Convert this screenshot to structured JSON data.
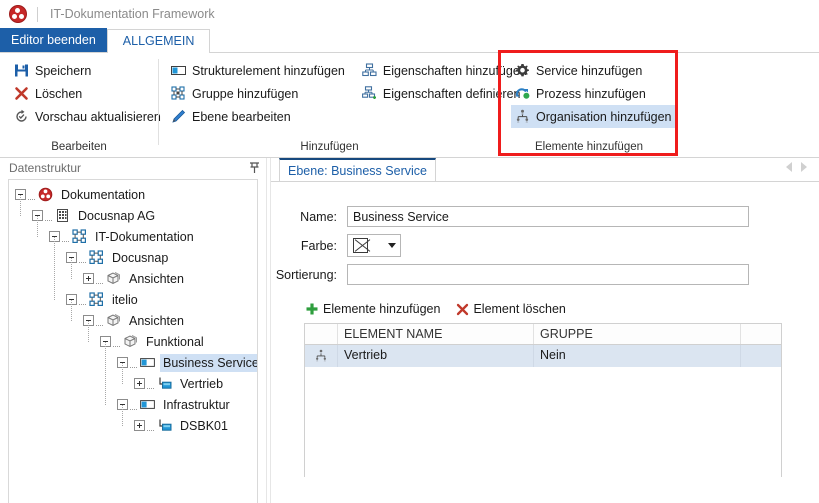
{
  "window": {
    "app_logo": "docusnap-logo-icon",
    "title": "IT-Dokumentation Framework"
  },
  "tabs": {
    "file_tab": "Editor beenden",
    "general_tab": "ALLGEMEIN"
  },
  "ribbon": {
    "groups": [
      {
        "name": "bearbeiten",
        "label": "Bearbeiten",
        "items": [
          {
            "label": "Speichern",
            "icon": "save-icon"
          },
          {
            "label": "Löschen",
            "icon": "delete-x-icon"
          },
          {
            "label": "Vorschau aktualisieren",
            "icon": "refresh-preview-icon"
          }
        ]
      },
      {
        "name": "hinzufuegen",
        "label": "Hinzufügen",
        "items_col1": [
          {
            "label": "Strukturelement hinzufügen",
            "icon": "structure-element-icon"
          },
          {
            "label": "Gruppe hinzufügen",
            "icon": "group-icon"
          },
          {
            "label": "Ebene bearbeiten",
            "icon": "pencil-edit-icon"
          }
        ],
        "items_col2": [
          {
            "label": "Eigenschaften hinzufügen",
            "icon": "properties-add-icon"
          },
          {
            "label": "Eigenschaften definieren",
            "icon": "properties-define-icon"
          }
        ]
      },
      {
        "name": "elemente-hinzufuegen",
        "label": "Elemente hinzufügen",
        "highlighted": true,
        "highlight_color": "#ef1c1c",
        "items": [
          {
            "label": "Service hinzufügen",
            "icon": "gear-icon",
            "selected": false
          },
          {
            "label": "Prozess hinzufügen",
            "icon": "process-icon",
            "selected": false
          },
          {
            "label": "Organisation hinzufügen",
            "icon": "organisation-icon",
            "selected": true
          }
        ]
      }
    ]
  },
  "left_panel": {
    "title": "Datenstruktur",
    "pin_icon": "pin-icon",
    "tree": [
      {
        "label": "Dokumentation",
        "icon": "documentation-icon",
        "indent": 0,
        "expander": "minus",
        "selected": false
      },
      {
        "label": "Docusnap AG",
        "icon": "company-icon",
        "indent": 1,
        "expander": "minus",
        "selected": false
      },
      {
        "label": "IT-Dokumentation",
        "icon": "sitemap-icon",
        "indent": 2,
        "expander": "minus",
        "selected": false
      },
      {
        "label": "Docusnap",
        "icon": "sitemap-icon",
        "indent": 3,
        "expander": "minus",
        "selected": false
      },
      {
        "label": "Ansichten",
        "icon": "views-icon",
        "indent": 4,
        "expander": "plus",
        "selected": false
      },
      {
        "label": "itelio",
        "icon": "sitemap-icon",
        "indent": 3,
        "expander": "minus",
        "selected": false
      },
      {
        "label": "Ansichten",
        "icon": "views-icon",
        "indent": 4,
        "expander": "minus",
        "selected": false
      },
      {
        "label": "Funktional",
        "icon": "views-icon",
        "indent": 5,
        "expander": "minus",
        "selected": false
      },
      {
        "label": "Business Service",
        "icon": "layer-icon",
        "indent": 6,
        "expander": "minus",
        "selected": true
      },
      {
        "label": "Vertrieb",
        "icon": "node-icon",
        "indent": 7,
        "expander": "plus",
        "selected": false
      },
      {
        "label": "Infrastruktur",
        "icon": "layer-icon",
        "indent": 6,
        "expander": "minus",
        "selected": false
      },
      {
        "label": "DSBK01",
        "icon": "node-icon",
        "indent": 7,
        "expander": "plus",
        "selected": false
      }
    ]
  },
  "content": {
    "doc_tab": "Ebene: Business Service",
    "nav_prev_icon": "chevron-left-icon",
    "nav_next_icon": "chevron-right-icon",
    "form": {
      "name_label": "Name:",
      "name_value": "Business Service",
      "name_placeholder": "",
      "color_label": "Farbe:",
      "color_swatch": "no-color-swatch",
      "color_dropdown_icon": "chevron-down-icon",
      "sort_label": "Sortierung:",
      "sort_value": "",
      "sort_placeholder": ""
    },
    "grid_toolbar": {
      "add_label": "Elemente hinzufügen",
      "add_icon": "plus-green-icon",
      "delete_label": "Element löschen",
      "delete_icon": "delete-x-icon"
    },
    "grid": {
      "columns": [
        "",
        "ELEMENT NAME",
        "GRUPPE",
        ""
      ],
      "rows": [
        {
          "icon": "organisation-icon",
          "element_name": "Vertrieb",
          "gruppe": "Nein",
          "extra": "",
          "selected": true
        }
      ]
    }
  },
  "colors": {
    "accent_blue": "#1d5fa8",
    "selection_blue": "#cfe0f4",
    "row_selection": "#dbe5f1",
    "annotation_red": "#ef1c1c",
    "delete_red": "#c0392b",
    "add_green": "#2e9e3e"
  }
}
